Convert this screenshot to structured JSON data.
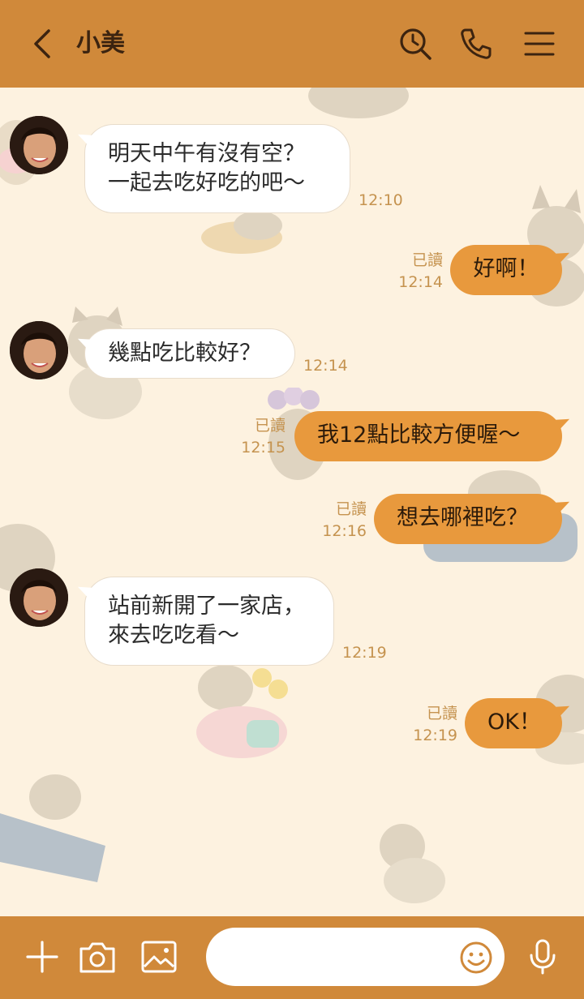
{
  "header": {
    "title": "小美",
    "bg_color": "#d0893a"
  },
  "icons": {
    "back": "chevron-left-icon",
    "search": "search-clock-icon",
    "call": "phone-icon",
    "menu": "hamburger-menu-icon",
    "add": "plus-icon",
    "camera": "camera-icon",
    "image": "image-icon",
    "emoji": "smiley-icon",
    "mic": "microphone-icon"
  },
  "colors": {
    "incoming_bubble": "#ffffff",
    "outgoing_bubble": "#e8993d",
    "background": "#fdf2e0",
    "meta_text": "#c5934f"
  },
  "messages": [
    {
      "dir": "in",
      "lines": [
        "明天中午有沒有空？",
        "一起去吃好吃的吧～"
      ],
      "time": "12:10"
    },
    {
      "dir": "out",
      "text": "好啊！",
      "read": "已讀",
      "time": "12:14"
    },
    {
      "dir": "in",
      "lines": [
        "幾點吃比較好？"
      ],
      "time": "12:14"
    },
    {
      "dir": "out",
      "text": "我12點比較方便喔～",
      "read": "已讀",
      "time": "12:15"
    },
    {
      "dir": "out",
      "text": "想去哪裡吃？",
      "read": "已讀",
      "time": "12:16"
    },
    {
      "dir": "in",
      "lines": [
        "站前新開了一家店，",
        "來去吃吃看～"
      ],
      "time": "12:19"
    },
    {
      "dir": "out",
      "text": "OK！",
      "read": "已讀",
      "time": "12:19"
    }
  ],
  "composer": {
    "value": "",
    "placeholder": ""
  }
}
